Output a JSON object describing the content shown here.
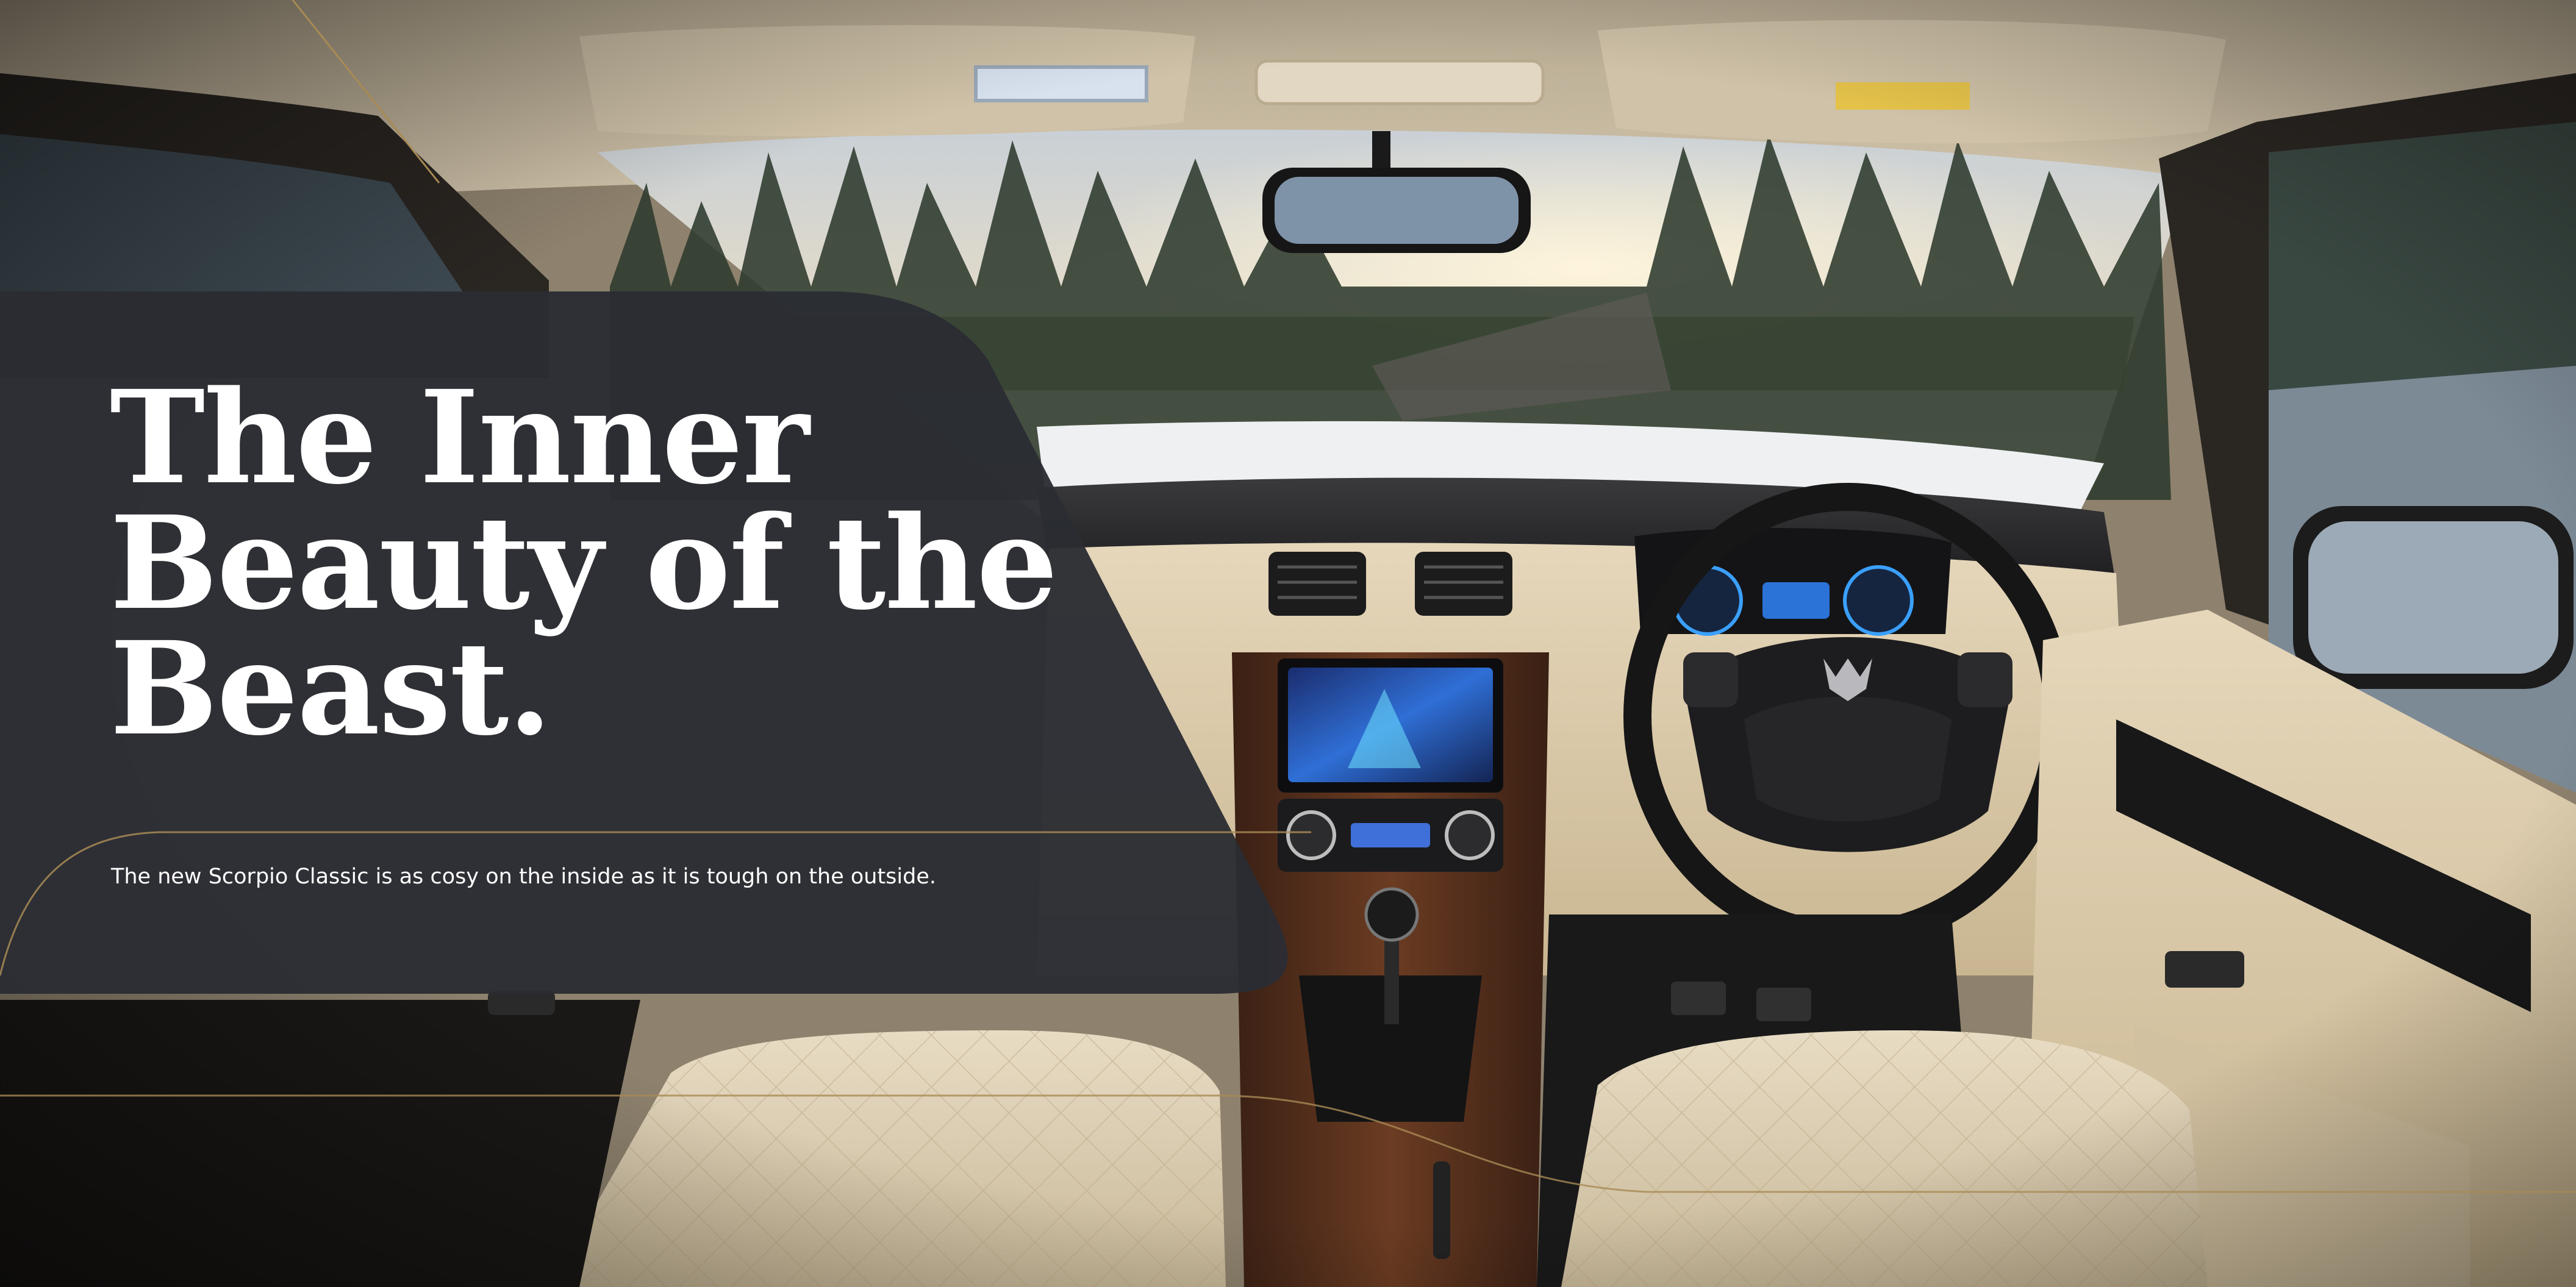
{
  "headline": {
    "line1": "The Inner",
    "line2": "Beauty of the",
    "line3": "Beast."
  },
  "subline": "The new Scorpio Classic is as cosy on the inside as it is tough on the outside.",
  "colors": {
    "panel": "#2b2d33",
    "accent_line": "#a88a55",
    "text": "#ffffff",
    "upholstery": "#d9c8a8"
  },
  "icons": {
    "steering_logo": "mahindra-logo-icon"
  }
}
